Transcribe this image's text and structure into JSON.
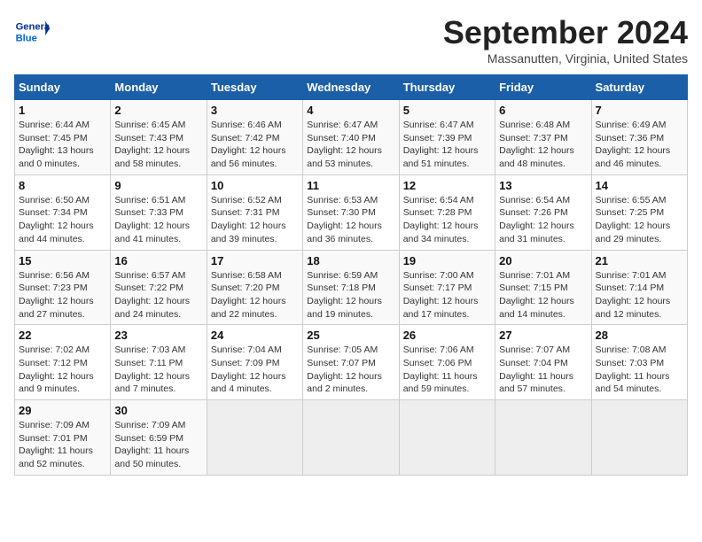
{
  "header": {
    "logo_text_general": "General",
    "logo_text_blue": "Blue",
    "month_title": "September 2024",
    "location": "Massanutten, Virginia, United States"
  },
  "weekdays": [
    "Sunday",
    "Monday",
    "Tuesday",
    "Wednesday",
    "Thursday",
    "Friday",
    "Saturday"
  ],
  "weeks": [
    [
      {
        "day": "1",
        "sunrise": "Sunrise: 6:44 AM",
        "sunset": "Sunset: 7:45 PM",
        "daylight": "Daylight: 13 hours and 0 minutes."
      },
      {
        "day": "2",
        "sunrise": "Sunrise: 6:45 AM",
        "sunset": "Sunset: 7:43 PM",
        "daylight": "Daylight: 12 hours and 58 minutes."
      },
      {
        "day": "3",
        "sunrise": "Sunrise: 6:46 AM",
        "sunset": "Sunset: 7:42 PM",
        "daylight": "Daylight: 12 hours and 56 minutes."
      },
      {
        "day": "4",
        "sunrise": "Sunrise: 6:47 AM",
        "sunset": "Sunset: 7:40 PM",
        "daylight": "Daylight: 12 hours and 53 minutes."
      },
      {
        "day": "5",
        "sunrise": "Sunrise: 6:47 AM",
        "sunset": "Sunset: 7:39 PM",
        "daylight": "Daylight: 12 hours and 51 minutes."
      },
      {
        "day": "6",
        "sunrise": "Sunrise: 6:48 AM",
        "sunset": "Sunset: 7:37 PM",
        "daylight": "Daylight: 12 hours and 48 minutes."
      },
      {
        "day": "7",
        "sunrise": "Sunrise: 6:49 AM",
        "sunset": "Sunset: 7:36 PM",
        "daylight": "Daylight: 12 hours and 46 minutes."
      }
    ],
    [
      {
        "day": "8",
        "sunrise": "Sunrise: 6:50 AM",
        "sunset": "Sunset: 7:34 PM",
        "daylight": "Daylight: 12 hours and 44 minutes."
      },
      {
        "day": "9",
        "sunrise": "Sunrise: 6:51 AM",
        "sunset": "Sunset: 7:33 PM",
        "daylight": "Daylight: 12 hours and 41 minutes."
      },
      {
        "day": "10",
        "sunrise": "Sunrise: 6:52 AM",
        "sunset": "Sunset: 7:31 PM",
        "daylight": "Daylight: 12 hours and 39 minutes."
      },
      {
        "day": "11",
        "sunrise": "Sunrise: 6:53 AM",
        "sunset": "Sunset: 7:30 PM",
        "daylight": "Daylight: 12 hours and 36 minutes."
      },
      {
        "day": "12",
        "sunrise": "Sunrise: 6:54 AM",
        "sunset": "Sunset: 7:28 PM",
        "daylight": "Daylight: 12 hours and 34 minutes."
      },
      {
        "day": "13",
        "sunrise": "Sunrise: 6:54 AM",
        "sunset": "Sunset: 7:26 PM",
        "daylight": "Daylight: 12 hours and 31 minutes."
      },
      {
        "day": "14",
        "sunrise": "Sunrise: 6:55 AM",
        "sunset": "Sunset: 7:25 PM",
        "daylight": "Daylight: 12 hours and 29 minutes."
      }
    ],
    [
      {
        "day": "15",
        "sunrise": "Sunrise: 6:56 AM",
        "sunset": "Sunset: 7:23 PM",
        "daylight": "Daylight: 12 hours and 27 minutes."
      },
      {
        "day": "16",
        "sunrise": "Sunrise: 6:57 AM",
        "sunset": "Sunset: 7:22 PM",
        "daylight": "Daylight: 12 hours and 24 minutes."
      },
      {
        "day": "17",
        "sunrise": "Sunrise: 6:58 AM",
        "sunset": "Sunset: 7:20 PM",
        "daylight": "Daylight: 12 hours and 22 minutes."
      },
      {
        "day": "18",
        "sunrise": "Sunrise: 6:59 AM",
        "sunset": "Sunset: 7:18 PM",
        "daylight": "Daylight: 12 hours and 19 minutes."
      },
      {
        "day": "19",
        "sunrise": "Sunrise: 7:00 AM",
        "sunset": "Sunset: 7:17 PM",
        "daylight": "Daylight: 12 hours and 17 minutes."
      },
      {
        "day": "20",
        "sunrise": "Sunrise: 7:01 AM",
        "sunset": "Sunset: 7:15 PM",
        "daylight": "Daylight: 12 hours and 14 minutes."
      },
      {
        "day": "21",
        "sunrise": "Sunrise: 7:01 AM",
        "sunset": "Sunset: 7:14 PM",
        "daylight": "Daylight: 12 hours and 12 minutes."
      }
    ],
    [
      {
        "day": "22",
        "sunrise": "Sunrise: 7:02 AM",
        "sunset": "Sunset: 7:12 PM",
        "daylight": "Daylight: 12 hours and 9 minutes."
      },
      {
        "day": "23",
        "sunrise": "Sunrise: 7:03 AM",
        "sunset": "Sunset: 7:11 PM",
        "daylight": "Daylight: 12 hours and 7 minutes."
      },
      {
        "day": "24",
        "sunrise": "Sunrise: 7:04 AM",
        "sunset": "Sunset: 7:09 PM",
        "daylight": "Daylight: 12 hours and 4 minutes."
      },
      {
        "day": "25",
        "sunrise": "Sunrise: 7:05 AM",
        "sunset": "Sunset: 7:07 PM",
        "daylight": "Daylight: 12 hours and 2 minutes."
      },
      {
        "day": "26",
        "sunrise": "Sunrise: 7:06 AM",
        "sunset": "Sunset: 7:06 PM",
        "daylight": "Daylight: 11 hours and 59 minutes."
      },
      {
        "day": "27",
        "sunrise": "Sunrise: 7:07 AM",
        "sunset": "Sunset: 7:04 PM",
        "daylight": "Daylight: 11 hours and 57 minutes."
      },
      {
        "day": "28",
        "sunrise": "Sunrise: 7:08 AM",
        "sunset": "Sunset: 7:03 PM",
        "daylight": "Daylight: 11 hours and 54 minutes."
      }
    ],
    [
      {
        "day": "29",
        "sunrise": "Sunrise: 7:09 AM",
        "sunset": "Sunset: 7:01 PM",
        "daylight": "Daylight: 11 hours and 52 minutes."
      },
      {
        "day": "30",
        "sunrise": "Sunrise: 7:09 AM",
        "sunset": "Sunset: 6:59 PM",
        "daylight": "Daylight: 11 hours and 50 minutes."
      },
      null,
      null,
      null,
      null,
      null
    ]
  ]
}
